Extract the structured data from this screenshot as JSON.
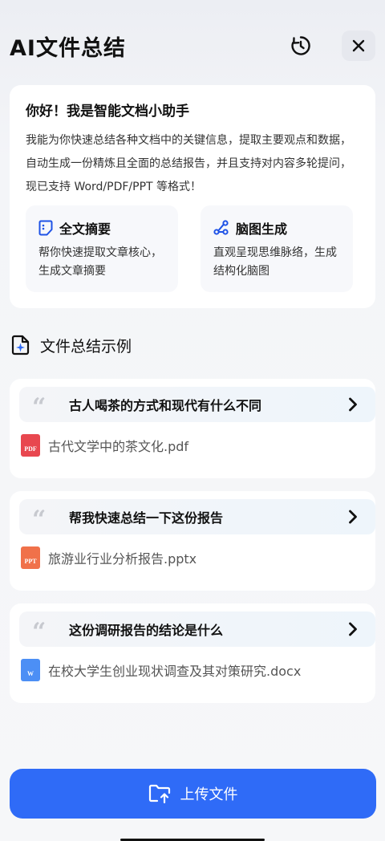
{
  "header": {
    "title": "AI文件总结",
    "history_icon": "history-clock-icon",
    "close_icon": "close-icon"
  },
  "intro": {
    "greeting": "你好！我是智能文档小助手",
    "description": "我能为你快速总结各种文档中的关键信息，提取主要观点和数据，自动生成一份精炼且全面的总结报告，并且支持对内容多轮提问，现已支持 Word/PDF/PPT 等格式！",
    "features": [
      {
        "title": "全文摘要",
        "desc": "帮你快速提取文章核心，生成文章摘要",
        "icon": "document-summary-icon"
      },
      {
        "title": "脑图生成",
        "desc": "直观呈现思维脉络，生成结构化脑图",
        "icon": "mindmap-icon"
      }
    ]
  },
  "section": {
    "title": "文件总结示例",
    "icon": "document-sparkle-icon"
  },
  "examples": [
    {
      "question": "古人喝茶的方式和现代有什么不同",
      "file_name": "古代文学中的茶文化.pdf",
      "file_type": "PDF",
      "color": "#e8474f"
    },
    {
      "question": "帮我快速总结一下这份报告",
      "file_name": "旅游业行业分析报告.pptx",
      "file_type": "PPT",
      "color": "#f0714a"
    },
    {
      "question": "这份调研报告的结论是什么",
      "file_name": "在校大学生创业现状调查及其对策研究.docx",
      "file_type": "W",
      "color": "#4c8ff5"
    }
  ],
  "upload": {
    "label": "上传文件",
    "icon": "folder-upload-icon"
  },
  "colors": {
    "accent": "#2f6bf7"
  }
}
